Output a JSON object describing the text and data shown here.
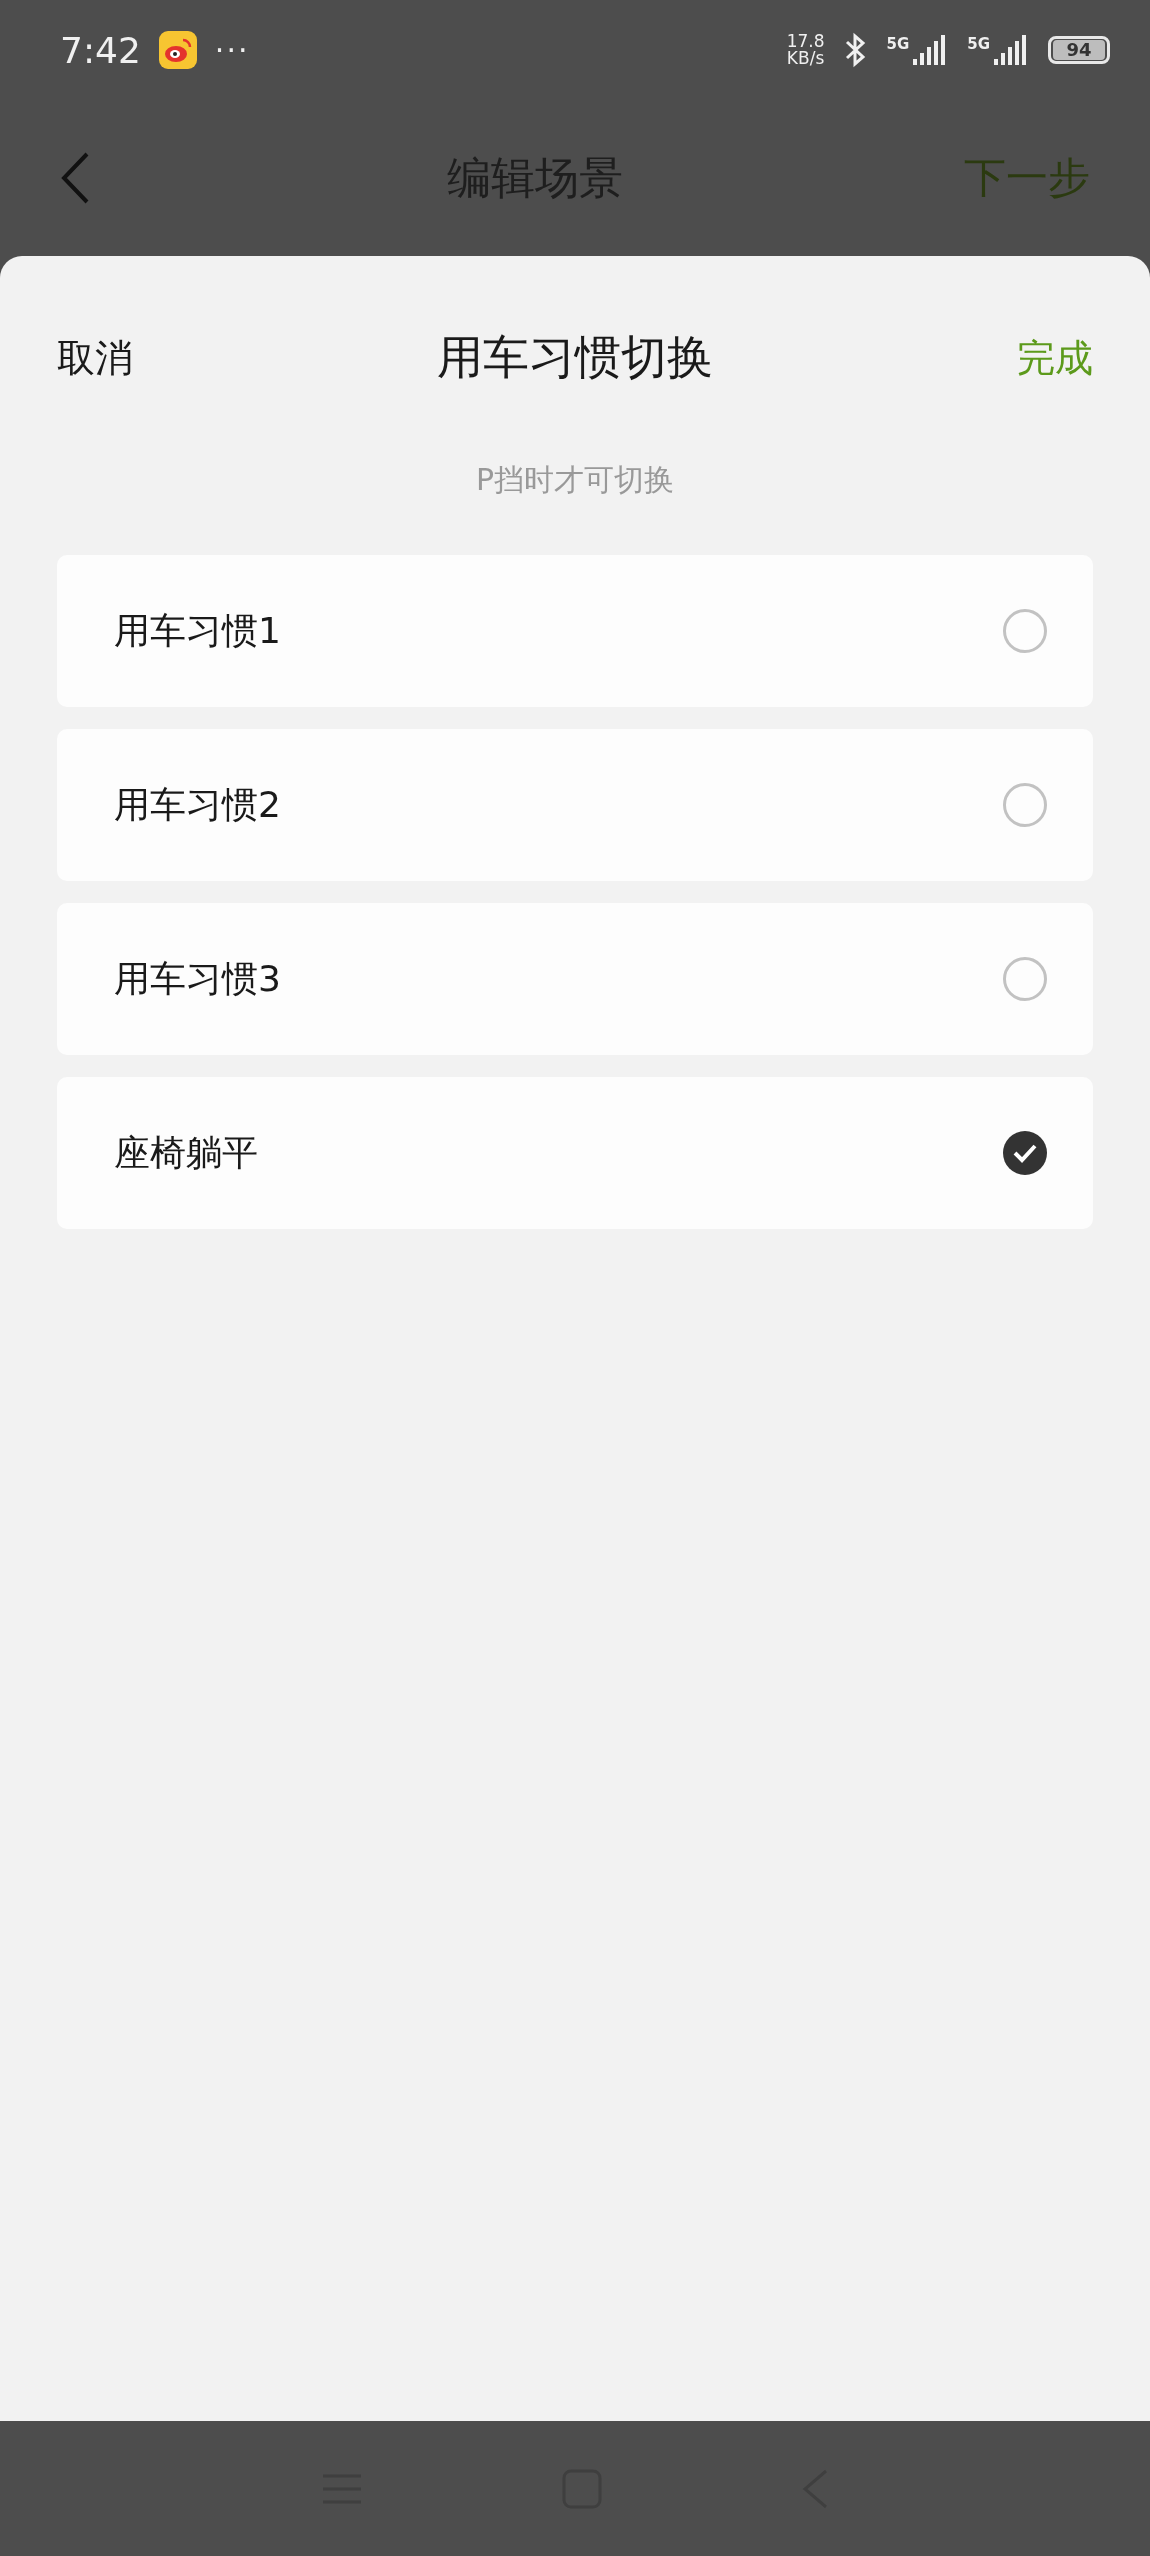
{
  "status_bar": {
    "time": "7:42",
    "more": "···",
    "net_speed": "17.8",
    "net_unit": "KB/s",
    "signals": [
      {
        "label": "5G"
      },
      {
        "label": "5G"
      }
    ],
    "battery": "94"
  },
  "header": {
    "title": "编辑场景",
    "action": "下一步"
  },
  "sheet": {
    "cancel": "取消",
    "title": "用车习惯切换",
    "done": "完成",
    "hint": "P挡时才可切换",
    "options": [
      {
        "label": "用车习惯1",
        "selected": false
      },
      {
        "label": "用车习惯2",
        "selected": false
      },
      {
        "label": "用车习惯3",
        "selected": false
      },
      {
        "label": "座椅躺平",
        "selected": true
      }
    ]
  }
}
